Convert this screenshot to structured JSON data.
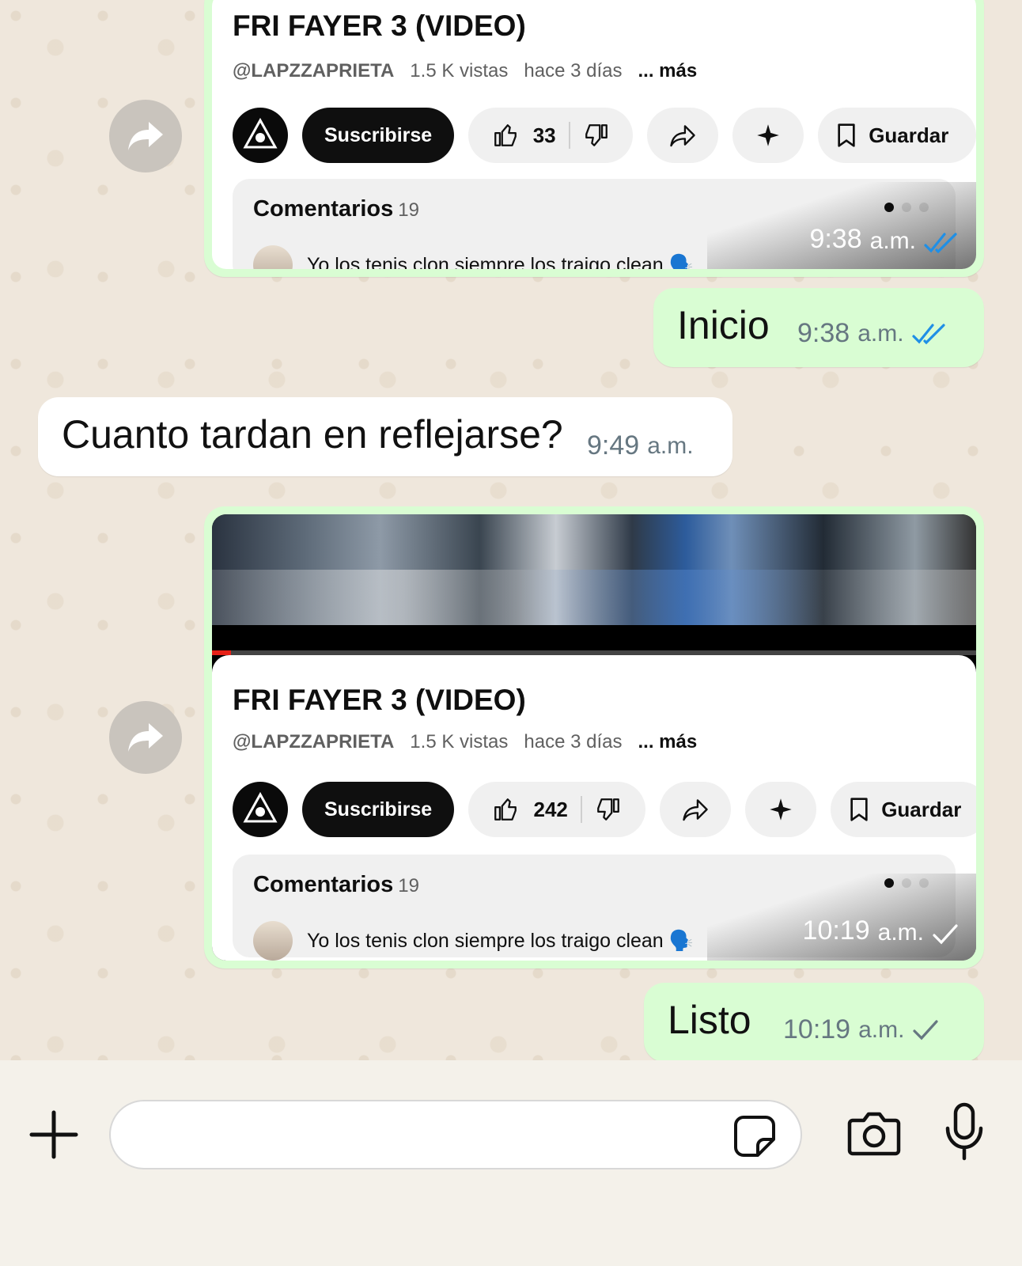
{
  "messages": {
    "m1": {
      "title": "FRI FAYER 3 (VIDEO)",
      "channel": "@LAPZZAPRIETA",
      "views": "1.5 K vistas",
      "age": "hace 3 días",
      "more": "... más",
      "subscribe": "Suscribirse",
      "likes": "33",
      "save": "Guardar",
      "comments_label": "Comentarios",
      "comments_count": "19",
      "comment_preview": "Yo los tenis clon siempre los traigo clean 🗣️",
      "time": "9:38",
      "ampm": "a.m.",
      "status": "read"
    },
    "m2": {
      "text": "Inicio",
      "time": "9:38",
      "ampm": "a.m.",
      "status": "read"
    },
    "m3": {
      "text": "Cuanto tardan en reflejarse?",
      "time": "9:49",
      "ampm": "a.m."
    },
    "m4": {
      "title": "FRI FAYER 3 (VIDEO)",
      "channel": "@LAPZZAPRIETA",
      "views": "1.5 K vistas",
      "age": "hace 3 días",
      "more": "... más",
      "subscribe": "Suscribirse",
      "likes": "242",
      "save": "Guardar",
      "comments_label": "Comentarios",
      "comments_count": "19",
      "comment_preview": "Yo los tenis clon siempre los traigo clean 🗣️",
      "time": "10:19",
      "ampm": "a.m.",
      "status": "sent"
    },
    "m5": {
      "text": "Listo",
      "time": "10:19",
      "ampm": "a.m.",
      "status": "sent"
    }
  },
  "colors": {
    "outgoing_bubble": "#d9fdd3",
    "incoming_bubble": "#ffffff",
    "read_tick": "#1f8fe6",
    "sent_tick": "#667781"
  },
  "input": {
    "placeholder": ""
  },
  "icons": [
    "forward-icon",
    "like-icon",
    "dislike-icon",
    "share-icon",
    "sparkle-icon",
    "bookmark-icon",
    "plus-icon",
    "sticker-icon",
    "camera-icon",
    "microphone-icon"
  ]
}
